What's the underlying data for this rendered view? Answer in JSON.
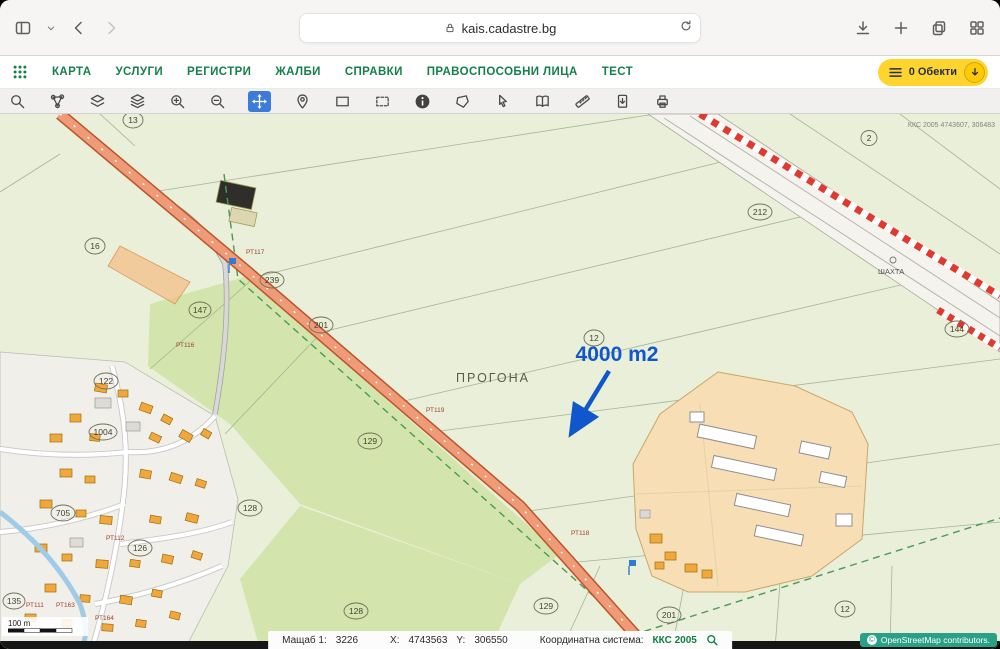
{
  "browser": {
    "url": "kais.cadastre.bg"
  },
  "nav": {
    "items": [
      "КАРТА",
      "УСЛУГИ",
      "РЕГИСТРИ",
      "ЖАЛБИ",
      "СПРАВКИ",
      "ПРАВОСПОСОБНИ ЛИЦА",
      "ТЕСТ"
    ],
    "objects_badge": "0 Обекти"
  },
  "toolbar": {
    "tools": [
      "search",
      "network",
      "layer-visibility",
      "layers",
      "zoom-in",
      "zoom-out",
      "pan",
      "location-pin",
      "rectangle-select",
      "rectangle-dashed-select",
      "info",
      "polygon-select",
      "pointer",
      "legend",
      "measure",
      "export",
      "print"
    ],
    "selected_tool": "pan"
  },
  "map": {
    "region_label": "ПРОГОНА",
    "area_annotation": "4000 m2",
    "shaft_label": "ШАХТА",
    "corner_coordinates": "ККС 2005 4743607, 306483",
    "scale_bar": "100 m",
    "parcel_numbers": [
      "13",
      "16",
      "2",
      "212",
      "239",
      "201",
      "147",
      "122",
      "1004",
      "129",
      "12",
      "128",
      "126",
      "705",
      "144",
      "128",
      "129",
      "201",
      "12",
      "135"
    ],
    "survey_points": [
      "РТ117",
      "РТ116",
      "РТ119",
      "РТ118",
      "РТ112",
      "РТ111",
      "РТ163",
      "РТ164"
    ],
    "osm": {
      "symbol": "©",
      "text": "OpenStreetMap  contributors."
    }
  },
  "statusbar": {
    "scale_label": "Мащаб 1:",
    "scale_value": "3226",
    "x_label": "X:",
    "x_value": "4743563",
    "y_label": "Y:",
    "y_value": "306550",
    "crs_label": "Координатна система:",
    "crs_value": "ККС 2005"
  },
  "colors": {
    "nav_green": "#15814a",
    "badge_yellow": "#ffd42e",
    "annotation_blue": "#1157cc",
    "selected_tool_blue": "#3d7bdb",
    "road_orange": "#f09b77",
    "osm_badge_teal": "#2aa187"
  }
}
